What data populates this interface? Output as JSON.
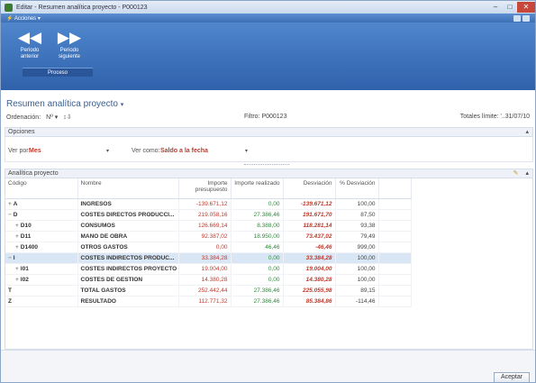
{
  "window": {
    "title": "Editar - Resumen analítica proyecto - P000123"
  },
  "ribbon": {
    "menu_label": "Acciones",
    "prev_button": "Periodo anterior",
    "next_button": "Periodo siguiente",
    "group_label": "Proceso"
  },
  "page": {
    "title": "Resumen analítica proyecto",
    "order_label": "Ordenación:",
    "order_value": "Nº",
    "filters": "Filtro: P000123",
    "totals": "Totales límite: '..31/07/10"
  },
  "options": {
    "header": "Opciones",
    "view_by_label": "Ver por:",
    "view_by_value": "Mes",
    "view_as_label": "Ver como:",
    "view_as_value": "Saldo a la fecha"
  },
  "grid": {
    "header": "Analítica proyecto",
    "columns": [
      "Código",
      "Nombre",
      "Importe presupuesto",
      "Importe realizado",
      "Desviación",
      "% Desviación"
    ],
    "rows": [
      {
        "code": "A",
        "name": "INGRESOS",
        "budget": "-139.671,12",
        "actual": "0,00",
        "deviation": "-139.671,12",
        "pct": "100,00",
        "exp": "+"
      },
      {
        "code": "D",
        "name": "COSTES DIRECTOS PRODUCCI...",
        "budget": "219.058,16",
        "actual": "27.386,46",
        "deviation": "191.671,70",
        "pct": "87,50",
        "exp": "−"
      },
      {
        "code": "D10",
        "name": "CONSUMOS",
        "budget": "126.669,14",
        "actual": "8.388,00",
        "deviation": "118.281,14",
        "pct": "93,38",
        "exp": "+"
      },
      {
        "code": "D11",
        "name": "MANO DE OBRA",
        "budget": "92.387,02",
        "actual": "18.950,00",
        "deviation": "73.437,02",
        "pct": "79,49",
        "exp": "+"
      },
      {
        "code": "D1400",
        "name": "OTROS GASTOS",
        "budget": "0,00",
        "actual": "46,46",
        "deviation": "-46,46",
        "pct": "999,00",
        "exp": "+"
      },
      {
        "code": "I",
        "name": "COSTES INDIRECTOS PRODUC...",
        "budget": "33.384,28",
        "actual": "0,00",
        "deviation": "33.384,28",
        "pct": "100,00",
        "exp": "−"
      },
      {
        "code": "I01",
        "name": "COSTES INDIRECTOS PROYECTO",
        "budget": "19.004,00",
        "actual": "0,00",
        "deviation": "19.004,00",
        "pct": "100,00",
        "exp": "+"
      },
      {
        "code": "I02",
        "name": "COSTES DE GESTION",
        "budget": "14.380,28",
        "actual": "0,00",
        "deviation": "14.380,28",
        "pct": "100,00",
        "exp": "+"
      },
      {
        "code": "T",
        "name": "TOTAL GASTOS",
        "budget": "252.442,44",
        "actual": "27.386,46",
        "deviation": "225.055,98",
        "pct": "89,15",
        "exp": ""
      },
      {
        "code": "Z",
        "name": "RESULTADO",
        "budget": "112.771,32",
        "actual": "27.386,46",
        "deviation": "85.384,86",
        "pct": "-114,46",
        "exp": ""
      }
    ]
  },
  "footer": {
    "accept": "Aceptar"
  }
}
